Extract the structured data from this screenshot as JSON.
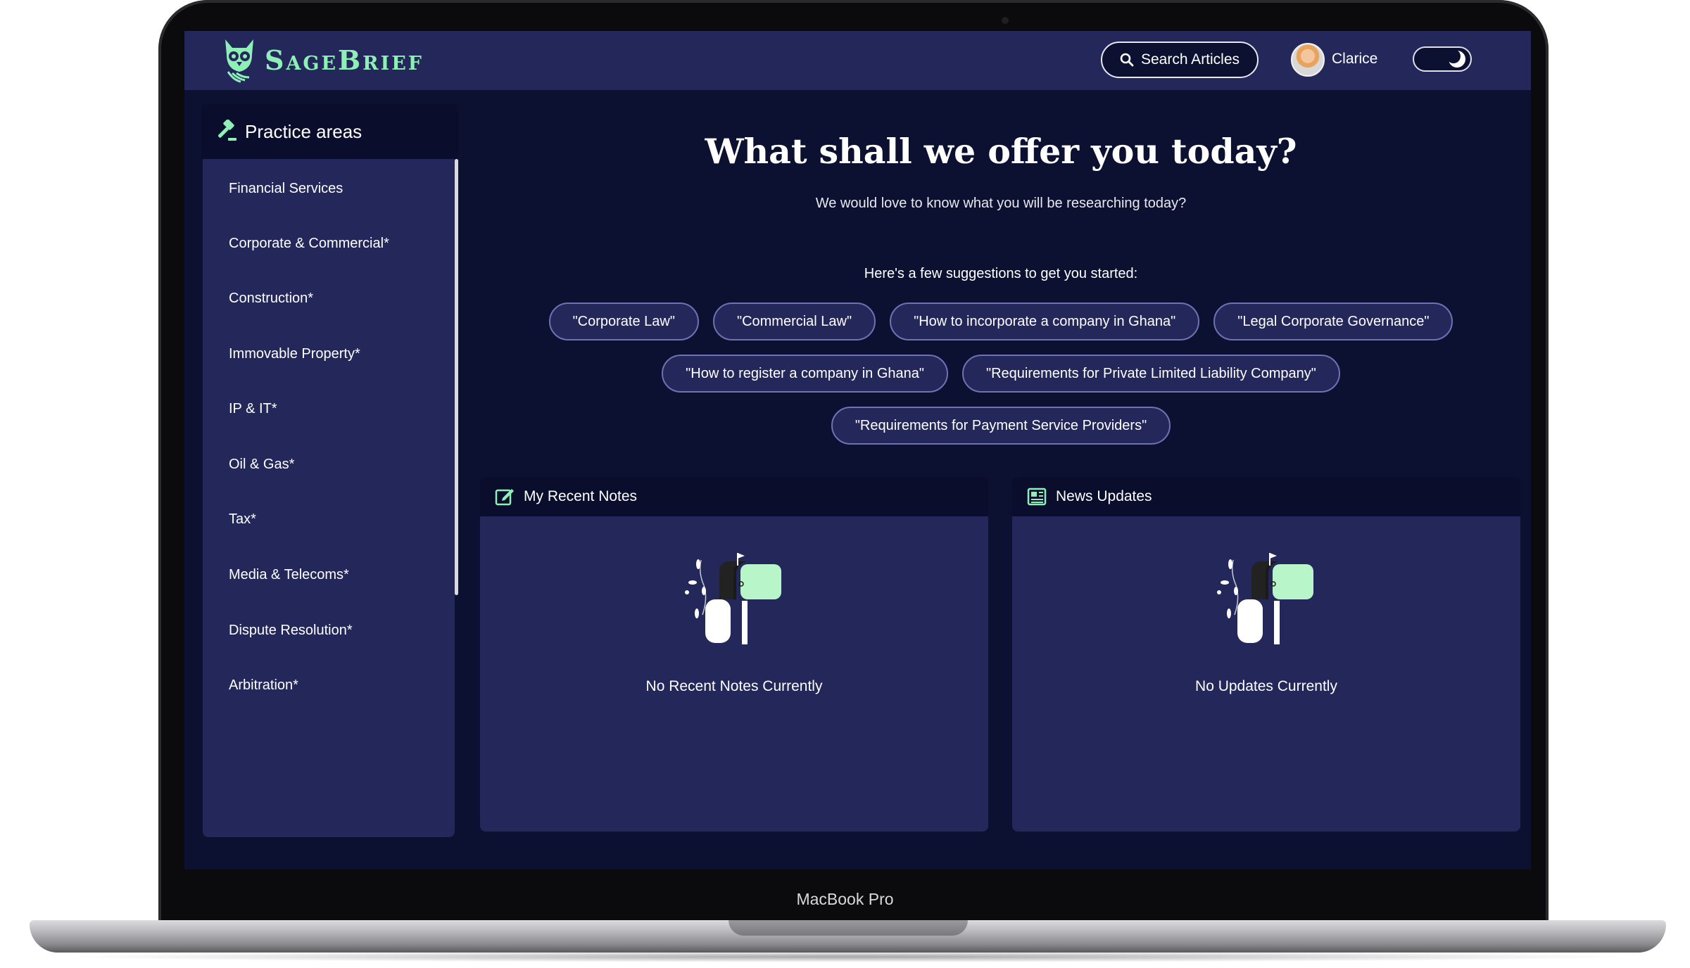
{
  "device_label": "MacBook Pro",
  "app": {
    "brand": "SageBrief",
    "search_button": "Search Articles",
    "user_name": "Clarice",
    "theme": "dark"
  },
  "sidebar": {
    "title": "Practice areas",
    "items": [
      "Financial Services",
      "Corporate & Commercial*",
      "Construction*",
      "Immovable Property*",
      "IP & IT*",
      "Oil & Gas*",
      "Tax*",
      "Media & Telecoms*",
      "Dispute Resolution*",
      "Arbitration*"
    ]
  },
  "hero": {
    "title": "What shall we offer you today?",
    "subtitle": "We would love to know what you will be researching today?",
    "suggestions_label": "Here's a few suggestions to get you started:"
  },
  "suggestions": [
    "\"Corporate Law\"",
    "\"Commercial Law\"",
    "\"How to incorporate a company in Ghana\"",
    "\"Legal Corporate Governance\"",
    "\"How to register a company in Ghana\"",
    "\"Requirements for Private Limited Liability Company\"",
    "\"Requirements for Payment Service Providers\""
  ],
  "notes_panel": {
    "title": "My Recent Notes",
    "empty_text": "No Recent Notes Currently"
  },
  "news_panel": {
    "title": "News Updates",
    "empty_text": "No Updates Currently"
  },
  "colors": {
    "accent": "#8ff0b7",
    "topbar": "#24275a",
    "background": "#0c1132",
    "panel": "#24275a"
  },
  "icons": {
    "logo": "owl-logo-icon",
    "search": "search-icon",
    "theme_toggle": "moon-icon",
    "practice_areas": "gavel-icon",
    "notes": "note-edit-icon",
    "news": "newspaper-icon",
    "empty_state": "mailbox-illustration"
  }
}
